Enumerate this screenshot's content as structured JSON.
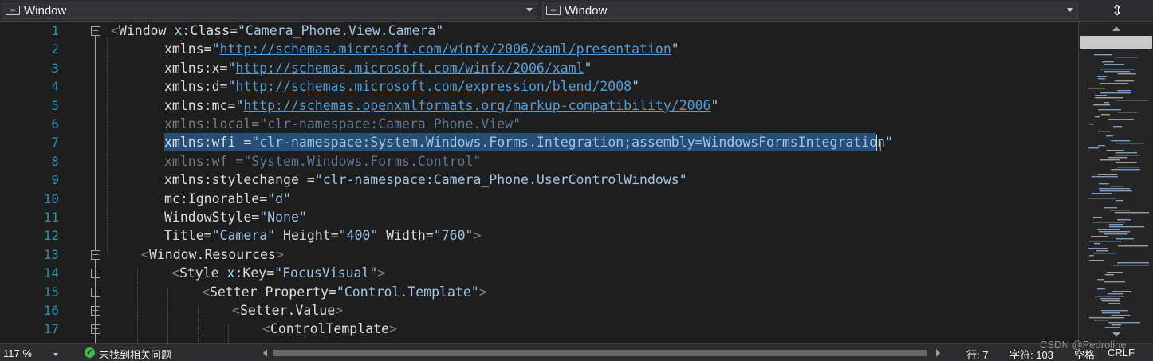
{
  "header": {
    "left_combo": "Window",
    "right_combo": "Window",
    "split_icon": "split-editor-icon"
  },
  "editor": {
    "line_numbers": [
      "1",
      "2",
      "3",
      "4",
      "5",
      "6",
      "7",
      "8",
      "9",
      "10",
      "11",
      "12",
      "13",
      "14",
      "15",
      "16",
      "17"
    ],
    "lines": [
      [
        [
          "br",
          "<"
        ],
        [
          "el",
          "Window "
        ],
        [
          "ns",
          "x"
        ],
        [
          "eq",
          ":"
        ],
        [
          "at",
          "Class"
        ],
        [
          "eq",
          "="
        ],
        [
          "str",
          "\"Camera_Phone.View.Camera\""
        ]
      ],
      [
        [
          "at",
          "xmlns"
        ],
        [
          "eq",
          "="
        ],
        [
          "str",
          "\""
        ],
        [
          "url",
          "http://schemas.microsoft.com/winfx/2006/xaml/presentation"
        ],
        [
          "str",
          "\""
        ]
      ],
      [
        [
          "at",
          "xmlns"
        ],
        [
          "eq",
          ":"
        ],
        [
          "at",
          "x"
        ],
        [
          "eq",
          "="
        ],
        [
          "str",
          "\""
        ],
        [
          "url",
          "http://schemas.microsoft.com/winfx/2006/xaml"
        ],
        [
          "str",
          "\""
        ]
      ],
      [
        [
          "at",
          "xmlns"
        ],
        [
          "eq",
          ":"
        ],
        [
          "at",
          "d"
        ],
        [
          "eq",
          "="
        ],
        [
          "str",
          "\""
        ],
        [
          "url",
          "http://schemas.microsoft.com/expression/blend/2008"
        ],
        [
          "str",
          "\""
        ]
      ],
      [
        [
          "at",
          "xmlns"
        ],
        [
          "eq",
          ":"
        ],
        [
          "at",
          "mc"
        ],
        [
          "eq",
          "="
        ],
        [
          "str",
          "\""
        ],
        [
          "url",
          "http://schemas.openxmlformats.org/markup-compatibility/2006"
        ],
        [
          "str",
          "\""
        ]
      ],
      [
        [
          "dim",
          "xmlns:local="
        ],
        [
          "dimstr",
          "\"clr-namespace:Camera_Phone.View\""
        ]
      ],
      [
        [
          "at",
          "xmlns"
        ],
        [
          "eq",
          ":"
        ],
        [
          "at",
          "wfi "
        ],
        [
          "eq",
          "="
        ],
        [
          "str",
          "\"clr-namespace:System.Windows.Forms.Integration;assembly=WindowsFormsIntegration\""
        ]
      ],
      [
        [
          "dim",
          "xmlns:wf ="
        ],
        [
          "dimstr",
          "\"System.Windows.Forms.Control\""
        ]
      ],
      [
        [
          "at",
          "xmlns"
        ],
        [
          "eq",
          ":"
        ],
        [
          "at",
          "stylechange "
        ],
        [
          "eq",
          "="
        ],
        [
          "str",
          "\"clr-namespace:Camera_Phone.UserControlWindows\""
        ]
      ],
      [
        [
          "at",
          "mc"
        ],
        [
          "eq",
          ":"
        ],
        [
          "at",
          "Ignorable"
        ],
        [
          "eq",
          "="
        ],
        [
          "str",
          "\"d\""
        ]
      ],
      [
        [
          "at",
          "WindowStyle"
        ],
        [
          "eq",
          "="
        ],
        [
          "str",
          "\"None\""
        ]
      ],
      [
        [
          "at",
          "Title"
        ],
        [
          "eq",
          "="
        ],
        [
          "str",
          "\"Camera\""
        ],
        [
          "at",
          " Height"
        ],
        [
          "eq",
          "="
        ],
        [
          "str",
          "\"400\""
        ],
        [
          "at",
          " Width"
        ],
        [
          "eq",
          "="
        ],
        [
          "str",
          "\"760\""
        ],
        [
          "br",
          ">"
        ]
      ],
      [
        [
          "br",
          "<"
        ],
        [
          "el",
          "Window.Resources"
        ],
        [
          "br",
          ">"
        ]
      ],
      [
        [
          "br",
          "<"
        ],
        [
          "el",
          "Style "
        ],
        [
          "ns",
          "x"
        ],
        [
          "eq",
          ":"
        ],
        [
          "at",
          "Key"
        ],
        [
          "eq",
          "="
        ],
        [
          "str",
          "\"FocusVisual\""
        ],
        [
          "br",
          ">"
        ]
      ],
      [
        [
          "br",
          "<"
        ],
        [
          "el",
          "Setter "
        ],
        [
          "at",
          "Property"
        ],
        [
          "eq",
          "="
        ],
        [
          "str",
          "\"Control.Template\""
        ],
        [
          "br",
          ">"
        ]
      ],
      [
        [
          "br",
          "<"
        ],
        [
          "el",
          "Setter.Value"
        ],
        [
          "br",
          ">"
        ]
      ],
      [
        [
          "br",
          "<"
        ],
        [
          "el",
          "ControlTemplate"
        ],
        [
          "br",
          ">"
        ]
      ]
    ]
  },
  "minimap": {
    "up_icon": "scroll-up-icon",
    "down_icon": "scroll-down-icon"
  },
  "status": {
    "zoom": "117 %",
    "issues_icon": "check-circle-icon",
    "issues_text": "未找到相关问题",
    "row": "行: 7",
    "col": "字符: 103",
    "whitespace": "空格",
    "eol": "CRLF",
    "watermark": "CSDN @Pedroline"
  },
  "colors": {
    "background": "#1e1e1e",
    "selection": "#264f78",
    "line_number": "#2b91af",
    "string": "#a0c4e6",
    "url": "#569cd6"
  }
}
